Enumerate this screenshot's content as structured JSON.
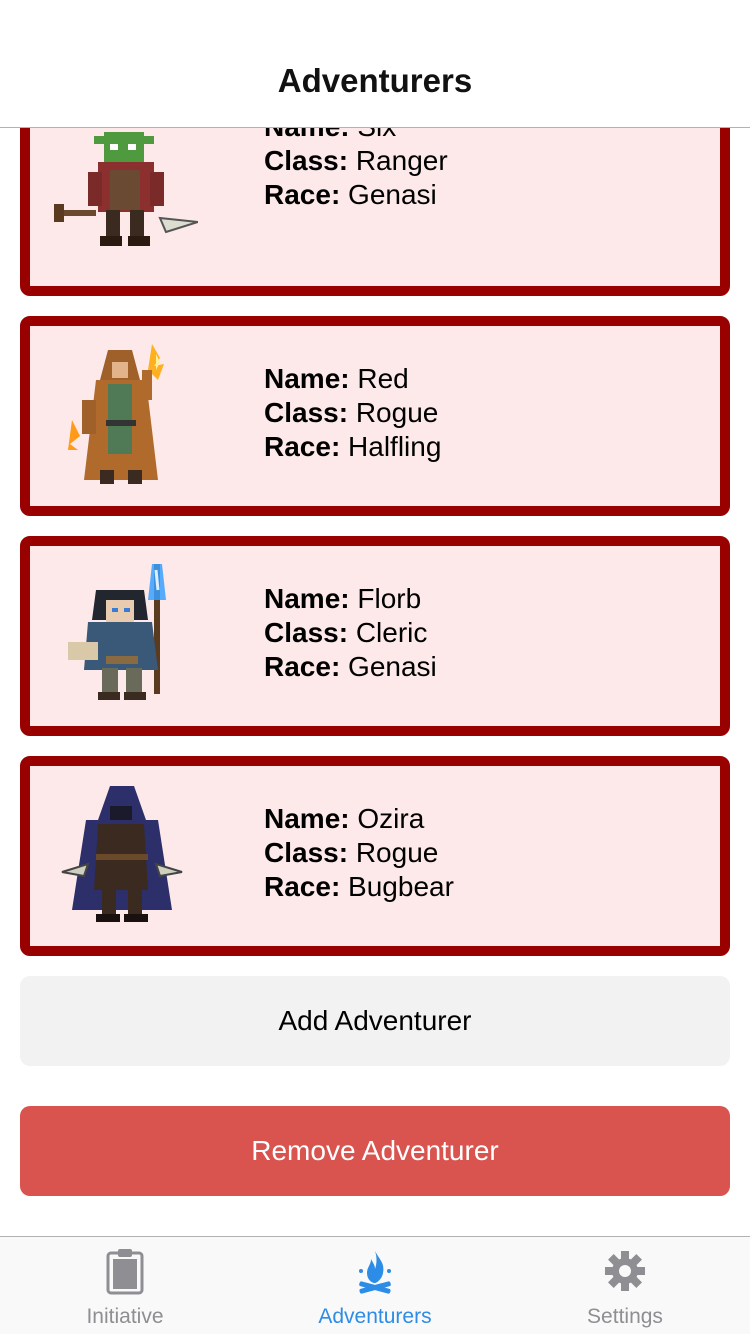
{
  "nav": {
    "title": "Adventurers"
  },
  "labels": {
    "name": "Name:",
    "class": "Class:",
    "race": "Race:"
  },
  "adventurers": [
    {
      "name": "Six",
      "class": "Ranger",
      "race": "Genasi",
      "portrait_icon": "goblin-ranger-sprite"
    },
    {
      "name": "Red",
      "class": "Rogue",
      "race": "Halfling",
      "portrait_icon": "hooded-mage-sprite"
    },
    {
      "name": "Florb",
      "class": "Cleric",
      "race": "Genasi",
      "portrait_icon": "staff-caster-sprite"
    },
    {
      "name": "Ozira",
      "class": "Rogue",
      "race": "Bugbear",
      "portrait_icon": "cloaked-assassin-sprite"
    }
  ],
  "buttons": {
    "add": "Add Adventurer",
    "remove": "Remove Adventurer"
  },
  "tabs": [
    {
      "label": "Initiative",
      "icon": "clipboard-icon",
      "active": false
    },
    {
      "label": "Adventurers",
      "icon": "campfire-icon",
      "active": true
    },
    {
      "label": "Settings",
      "icon": "gear-icon",
      "active": false
    }
  ],
  "colors": {
    "card_border": "#990000",
    "card_bg": "#fde9e9",
    "remove_button": "#d9534f",
    "add_button": "#f2f2f2",
    "tab_active": "#2d8ce6",
    "tab_inactive": "#8e8e93"
  }
}
